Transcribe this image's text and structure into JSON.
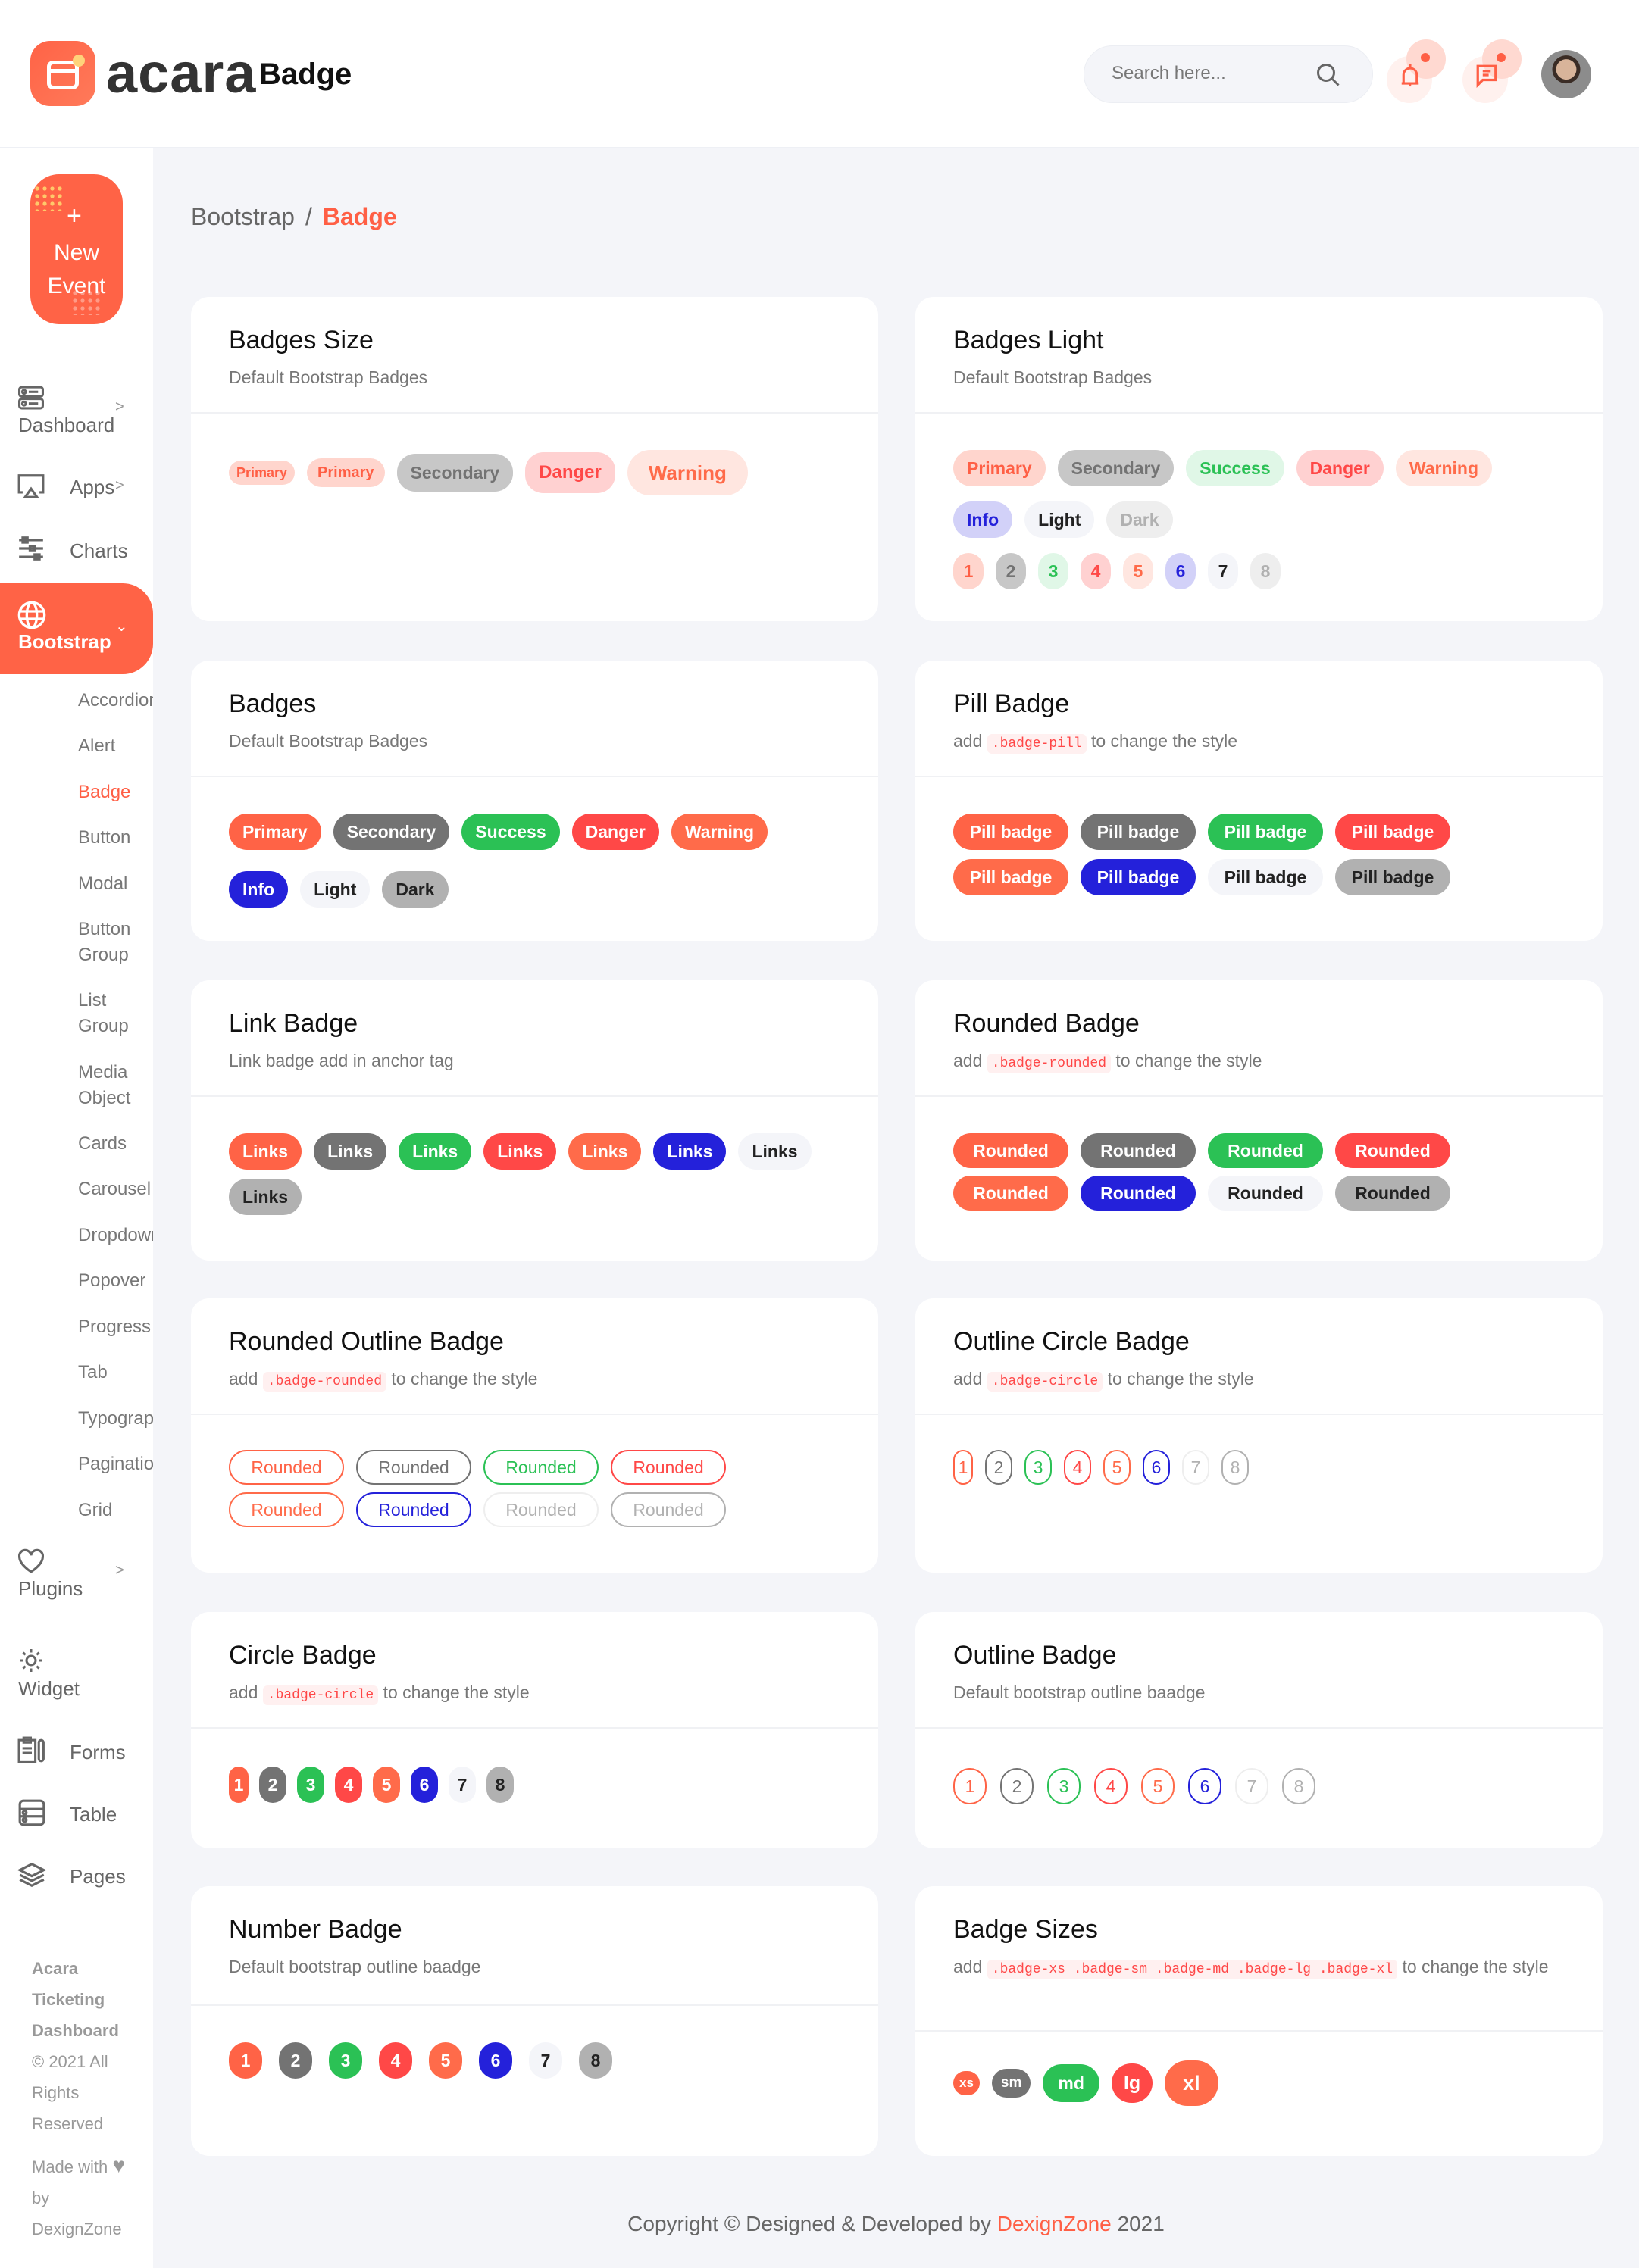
{
  "header": {
    "brand": "acara",
    "page_title": "Badge",
    "search_placeholder": "Search here...",
    "icons": [
      "search-icon",
      "bell-icon",
      "chat-icon"
    ]
  },
  "sidebar": {
    "new_event": {
      "plus": "+",
      "label_line1": "New",
      "label_line2": "Event"
    },
    "items": [
      {
        "label": "Dashboard",
        "icon": "dashboard-icon"
      },
      {
        "label": "Apps",
        "icon": "airplay-icon"
      },
      {
        "label": "Charts",
        "icon": "sliders-icon"
      },
      {
        "label": "Bootstrap",
        "icon": "globe-icon",
        "active": true
      },
      {
        "label": "Plugins",
        "icon": "heart-icon"
      },
      {
        "label": "Widget",
        "icon": "gear-icon"
      },
      {
        "label": "Forms",
        "icon": "clipboard-icon"
      },
      {
        "label": "Table",
        "icon": "table-icon"
      },
      {
        "label": "Pages",
        "icon": "layers-icon"
      }
    ],
    "sub_items": [
      "Accordion",
      "Alert",
      "Badge",
      "Button",
      "Modal",
      "Button Group",
      "List Group",
      "Media Object",
      "Cards",
      "Carousel",
      "Dropdown",
      "Popover",
      "Progress",
      "Tab",
      "Typography",
      "Pagination",
      "Grid"
    ],
    "active_sub": "Badge",
    "footer": {
      "app_name": "Acara Ticketing Dashboard",
      "rights": "© 2021 All Rights Reserved",
      "made_with": "Made with",
      "by": "by DexignZone"
    }
  },
  "breadcrumb": {
    "parent": "Bootstrap",
    "separator": "/",
    "current": "Badge"
  },
  "cards": {
    "badges_size": {
      "title": "Badges Size",
      "desc": "Default Bootstrap Badges",
      "badges": [
        "Primary",
        "Primary",
        "Secondary",
        "Danger",
        "Warning"
      ]
    },
    "badges_light": {
      "title": "Badges Light",
      "desc": "Default Bootstrap Badges",
      "badges": [
        "Primary",
        "Secondary",
        "Success",
        "Danger",
        "Warning",
        "Info",
        "Light",
        "Dark"
      ],
      "numbers": [
        "1",
        "2",
        "3",
        "4",
        "5",
        "6",
        "7",
        "8"
      ]
    },
    "badges": {
      "title": "Badges",
      "desc": "Default Bootstrap Badges",
      "badges": [
        "Primary",
        "Secondary",
        "Success",
        "Danger",
        "Warning",
        "Info",
        "Light",
        "Dark"
      ]
    },
    "pill": {
      "title": "Pill Badge",
      "desc_pre": "add",
      "code": ".badge-pill",
      "desc_post": "to change the style",
      "badges": [
        "Pill badge",
        "Pill badge",
        "Pill badge",
        "Pill badge",
        "Pill badge",
        "Pill badge",
        "Pill badge",
        "Pill badge"
      ]
    },
    "link": {
      "title": "Link Badge",
      "desc": "Link badge add in anchor tag",
      "badges": [
        "Links",
        "Links",
        "Links",
        "Links",
        "Links",
        "Links",
        "Links",
        "Links"
      ]
    },
    "rounded": {
      "title": "Rounded Badge",
      "desc_pre": "add",
      "code": ".badge-rounded",
      "desc_post": "to change the style",
      "badges": [
        "Rounded",
        "Rounded",
        "Rounded",
        "Rounded",
        "Rounded",
        "Rounded",
        "Rounded",
        "Rounded"
      ]
    },
    "rounded_outline": {
      "title": "Rounded Outline Badge",
      "desc_pre": "add",
      "code": ".badge-rounded",
      "desc_post": "to change the style",
      "badges": [
        "Rounded",
        "Rounded",
        "Rounded",
        "Rounded",
        "Rounded",
        "Rounded",
        "Rounded",
        "Rounded"
      ]
    },
    "outline_circle": {
      "title": "Outline Circle Badge",
      "desc_pre": "add",
      "code": ".badge-circle",
      "desc_post": "to change the style",
      "numbers": [
        "1",
        "2",
        "3",
        "4",
        "5",
        "6",
        "7",
        "8"
      ]
    },
    "circle": {
      "title": "Circle Badge",
      "desc_pre": "add",
      "code": ".badge-circle",
      "desc_post": "to change the style",
      "numbers": [
        "1",
        "2",
        "3",
        "4",
        "5",
        "6",
        "7",
        "8"
      ]
    },
    "outline": {
      "title": "Outline Badge",
      "desc": "Default bootstrap outline baadge",
      "numbers": [
        "1",
        "2",
        "3",
        "4",
        "5",
        "6",
        "7",
        "8"
      ]
    },
    "number": {
      "title": "Number Badge",
      "desc": "Default bootstrap outline baadge",
      "numbers": [
        "1",
        "2",
        "3",
        "4",
        "5",
        "6",
        "7",
        "8"
      ]
    },
    "sizes": {
      "title": "Badge Sizes",
      "desc_pre": "add",
      "code": ".badge-xs .badge-sm .badge-md .badge-lg .badge-xl",
      "desc_post": "to change the style",
      "badges": [
        "xs",
        "sm",
        "md",
        "lg",
        "xl"
      ]
    }
  },
  "colors": {
    "primary": "#ff6346",
    "secondary": "#737373",
    "success": "#2bc155",
    "danger": "#ff4847",
    "warning": "#ff6b4a",
    "info": "#2421da",
    "light": "#f4f5f9",
    "dark": "#b1b1b1"
  },
  "footer": {
    "text": "Copyright © Designed & Developed by",
    "brand": "DexignZone",
    "year": "2021"
  }
}
